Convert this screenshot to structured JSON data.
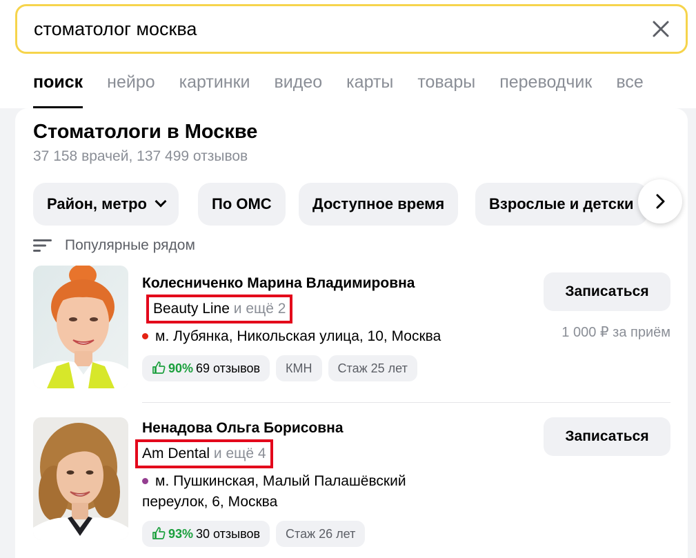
{
  "search": {
    "query": "стоматолог москва"
  },
  "tabs": [
    {
      "label": "поиск",
      "active": true
    },
    {
      "label": "нейро"
    },
    {
      "label": "картинки"
    },
    {
      "label": "видео"
    },
    {
      "label": "карты"
    },
    {
      "label": "товары"
    },
    {
      "label": "переводчик"
    },
    {
      "label": "все"
    }
  ],
  "results": {
    "title": "Стоматологи в Москве",
    "subtitle": "37 158 врачей, 137 499 отзывов",
    "filters": [
      "Район, метро",
      "По ОМС",
      "Доступное время",
      "Взрослые и детски"
    ],
    "sort_label": "Популярные рядом",
    "doctors": [
      {
        "name": "Колесниченко Марина Владимировна",
        "clinic": "Beauty Line",
        "clinic_more": "и ещё 2",
        "address": "м. Лубянка, Никольская улица, 10, Москва",
        "metro_color": "#e42313",
        "rating_pct": "90%",
        "reviews": "69 отзывов",
        "degree": "КМН",
        "experience": "Стаж 25 лет",
        "book_label": "Записаться",
        "price": "1 000 ₽ за приём"
      },
      {
        "name": "Ненадова Ольга Борисовна",
        "clinic": "Am Dental",
        "clinic_more": "и ещё 4",
        "address_line1": "м. Пушкинская, Малый Палашёвский",
        "address_line2": "переулок, 6, Москва",
        "metro_color": "#943e90",
        "rating_pct": "93%",
        "reviews": "30 отзывов",
        "experience": "Стаж 26 лет",
        "book_label": "Записаться"
      }
    ]
  },
  "colors": {
    "search_border": "#f6d44c",
    "highlight_box": "#e3061b",
    "rating_green": "#1a9f3c"
  }
}
